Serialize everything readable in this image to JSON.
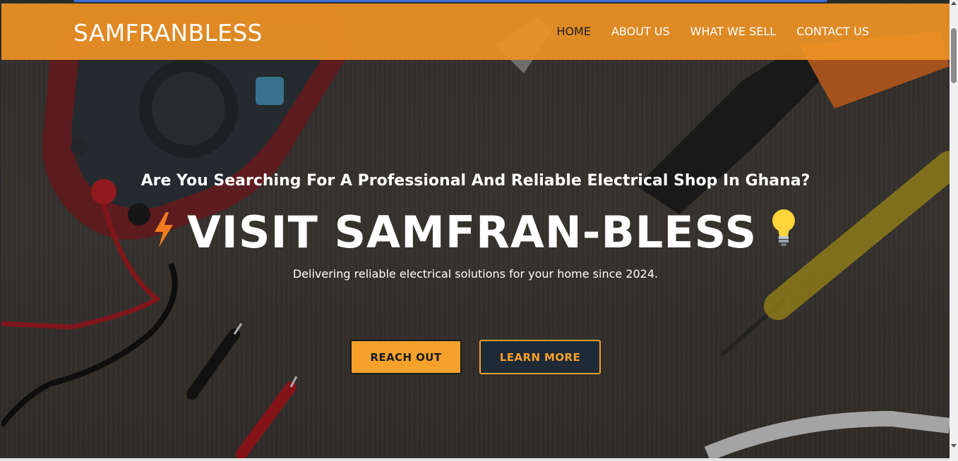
{
  "header": {
    "brand": "SAMFRANBLESS",
    "nav": [
      {
        "label": "HOME",
        "active": true
      },
      {
        "label": "ABOUT US",
        "active": false
      },
      {
        "label": "WHAT WE SELL",
        "active": false
      },
      {
        "label": "CONTACT US",
        "active": false
      }
    ]
  },
  "hero": {
    "kicker": "Are You Searching For A Professional And Reliable Electrical Shop In Ghana?",
    "headline": "VISIT SAMFRAN-BLESS",
    "headline_left_icon": "lightning-bolt-icon",
    "headline_right_icon": "light-bulb-icon",
    "subtitle": "Delivering reliable electrical solutions for your home since 2024.",
    "buttons": {
      "primary": "REACH OUT",
      "secondary": "LEARN MORE"
    }
  },
  "colors": {
    "accent": "#f6a12c",
    "navbar": "#ec9125",
    "dark_button": "#1e2a36"
  }
}
